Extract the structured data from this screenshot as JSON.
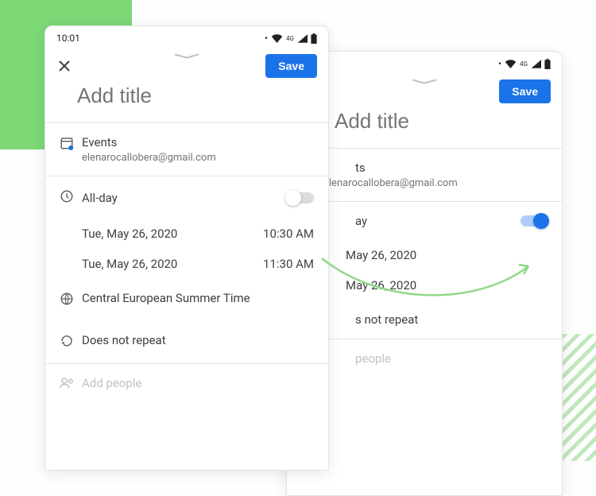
{
  "status": {
    "time": "10:01",
    "network_label": "4G"
  },
  "save_label": "Save",
  "title_placeholder": "Add title",
  "calendar": {
    "name": "Events",
    "email": "elenarocallobera@gmail.com"
  },
  "allday_label": "All-day",
  "front": {
    "allday_on": false,
    "start_date": "Tue, May 26, 2020",
    "start_time": "10:30 AM",
    "end_date": "Tue, May 26, 2020",
    "end_time": "11:30 AM"
  },
  "back": {
    "allday_on": true,
    "start_date": "May 26, 2020",
    "end_date": "May 26, 2020",
    "repeat_partial": "s not repeat",
    "people_partial": "people"
  },
  "timezone_label": "Central European Summer Time",
  "repeat_label": "Does not repeat",
  "add_people_label": "Add people",
  "colors": {
    "accent": "#1a73e8",
    "green": "#7dd876"
  }
}
